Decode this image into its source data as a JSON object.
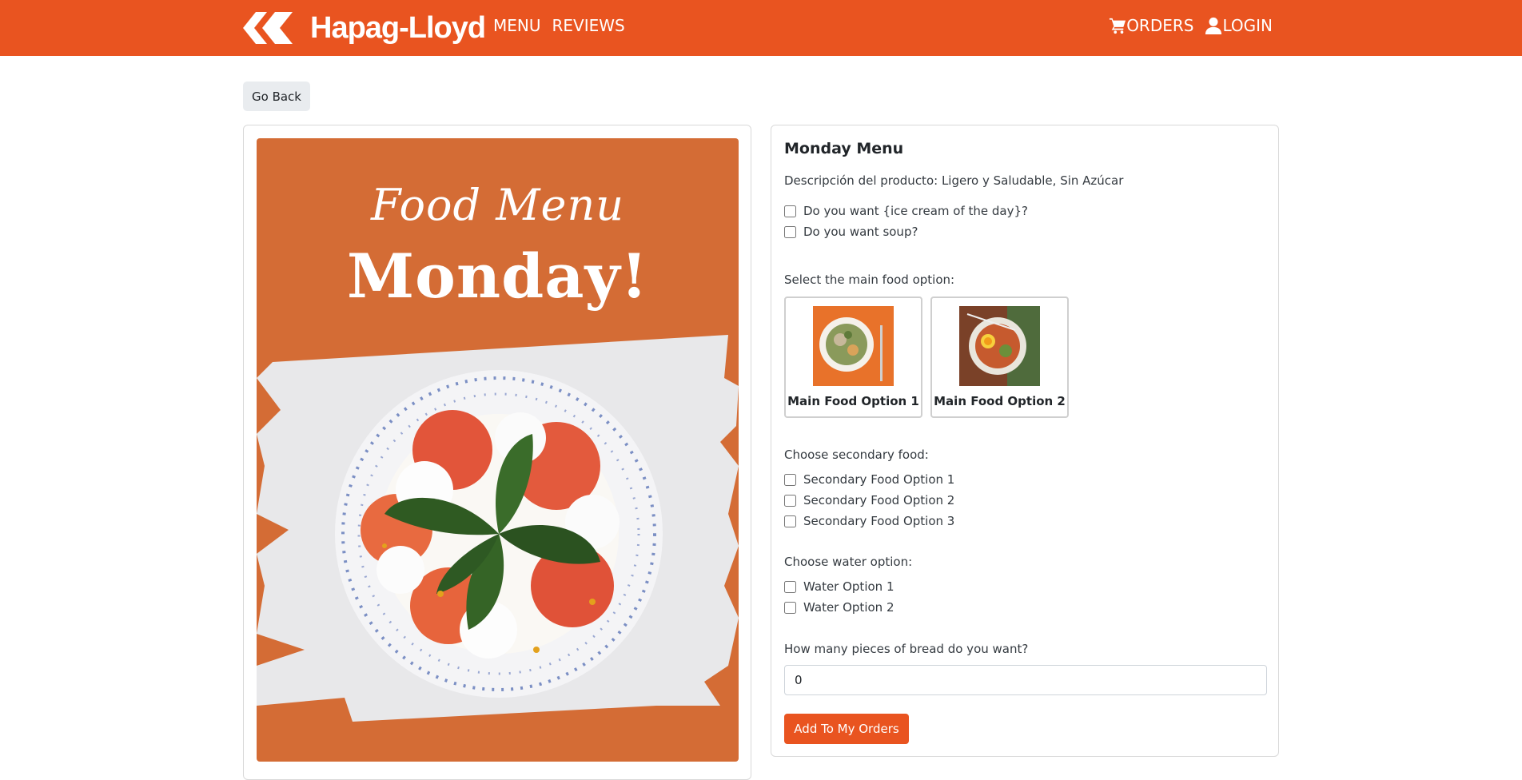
{
  "navbar": {
    "brand": "Hapag-Lloyd",
    "links": [
      "MENU",
      "REVIEWS"
    ],
    "orders_label": "ORDERS",
    "login_label": "LOGIN"
  },
  "go_back_label": "Go Back",
  "poster": {
    "script_text": "Food Menu",
    "title": "Monday!"
  },
  "product": {
    "title": "Monday Menu",
    "description": "Descripción del producto: Ligero y Saludable, Sin Azúcar",
    "extras": [
      {
        "label": "Do you want {ice cream of the day}?",
        "checked": false
      },
      {
        "label": "Do you want soup?",
        "checked": false
      }
    ],
    "main_food_label": "Select the main food option:",
    "main_options": [
      "Main Food Option 1",
      "Main Food Option 2"
    ],
    "secondary_label": "Choose secondary food:",
    "secondary_options": [
      "Secondary Food Option 1",
      "Secondary Food Option 2",
      "Secondary Food Option 3"
    ],
    "water_label": "Choose water option:",
    "water_options": [
      "Water Option 1",
      "Water Option 2"
    ],
    "bread_label": "How many pieces of bread do you want?",
    "bread_value": "0",
    "add_button": "Add To My Orders"
  },
  "colors": {
    "brand": "#e95420",
    "poster_bg": "#d46c35"
  }
}
